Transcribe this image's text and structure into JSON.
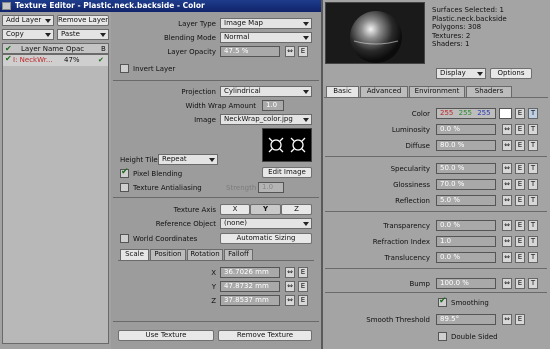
{
  "window": {
    "title": "Texture Editor - Plastic.neck.backside - Color"
  },
  "layers": {
    "add_layer": "Add Layer",
    "remove_layer": "Remove Layer",
    "copy": "Copy",
    "paste": "Paste",
    "col_name": "Layer Name",
    "col_opac": "Opac",
    "col_b": "B",
    "row_name": "I: NeckWr...",
    "row_opac": "47%"
  },
  "layer_settings": {
    "layer_type_label": "Layer Type",
    "layer_type_value": "Image Map",
    "blending_mode_label": "Blending Mode",
    "blending_mode_value": "Normal",
    "layer_opacity_label": "Layer Opacity",
    "layer_opacity_value": "47.5 %",
    "invert_layer_label": "Invert Layer",
    "e_label": "E"
  },
  "image_settings": {
    "projection_label": "Projection",
    "projection_value": "Cylindrical",
    "width_wrap_label": "Width Wrap Amount",
    "width_wrap_value": "1.0",
    "image_label": "Image",
    "image_value": "NeckWrap_color.jpg",
    "edit_image": "Edit Image",
    "height_tile_label": "Height Tile",
    "height_tile_value": "Repeat",
    "pixel_blending_label": "Pixel Blending",
    "texture_antialiasing_label": "Texture Antialiasing",
    "strength_label": "Strength",
    "strength_value": "1.0"
  },
  "axis_settings": {
    "texture_axis_label": "Texture Axis",
    "axis_x": "X",
    "axis_y": "Y",
    "axis_z": "Z",
    "reference_object_label": "Reference Object",
    "reference_object_value": "(none)",
    "world_coordinates_label": "World Coordinates",
    "automatic_sizing": "Automatic Sizing"
  },
  "transform_tabs": [
    "Scale",
    "Position",
    "Rotation",
    "Falloff"
  ],
  "scale": {
    "x_label": "X",
    "x_value": "36.7026 mm",
    "y_label": "Y",
    "y_value": "47.8732 mm",
    "z_label": "Z",
    "z_value": "37.8537 mm"
  },
  "bottom_buttons": {
    "use_texture": "Use Texture",
    "remove_texture": "Remove Texture"
  },
  "surface_info": {
    "surfaces_selected": "Surfaces Selected: 1",
    "name": "Plastic.neck.backside",
    "polygons": "Polygons: 308",
    "textures": "Textures: 2",
    "shaders": "Shaders: 1"
  },
  "preview": {
    "display": "Display",
    "options": "Options"
  },
  "surface_tabs": [
    "Basic",
    "Advanced",
    "Environment",
    "Shaders"
  ],
  "surface_props": {
    "color_label": "Color",
    "color_r": "255",
    "color_g": "255",
    "color_b": "255",
    "luminosity_label": "Luminosity",
    "luminosity_value": "0.0 %",
    "diffuse_label": "Diffuse",
    "diffuse_value": "80.0 %",
    "specularity_label": "Specularity",
    "specularity_value": "50.0 %",
    "glossiness_label": "Glossiness",
    "glossiness_value": "70.0 %",
    "reflection_label": "Reflection",
    "reflection_value": "5.0 %",
    "transparency_label": "Transparency",
    "transparency_value": "0.0 %",
    "refraction_label": "Refraction Index",
    "refraction_value": "1.0",
    "translucency_label": "Translucency",
    "translucency_value": "0.0 %",
    "bump_label": "Bump",
    "bump_value": "100.0 %",
    "smoothing_label": "Smoothing",
    "smooth_threshold_label": "Smooth Threshold",
    "smooth_threshold_value": "89.5°",
    "double_sided_label": "Double Sided",
    "e_label": "E",
    "t_label": "T"
  },
  "colors": {
    "color_swatch": "#ffffff",
    "r_color": "#c0282a",
    "g_color": "#2a8a2a",
    "b_color": "#2a3ab4"
  }
}
